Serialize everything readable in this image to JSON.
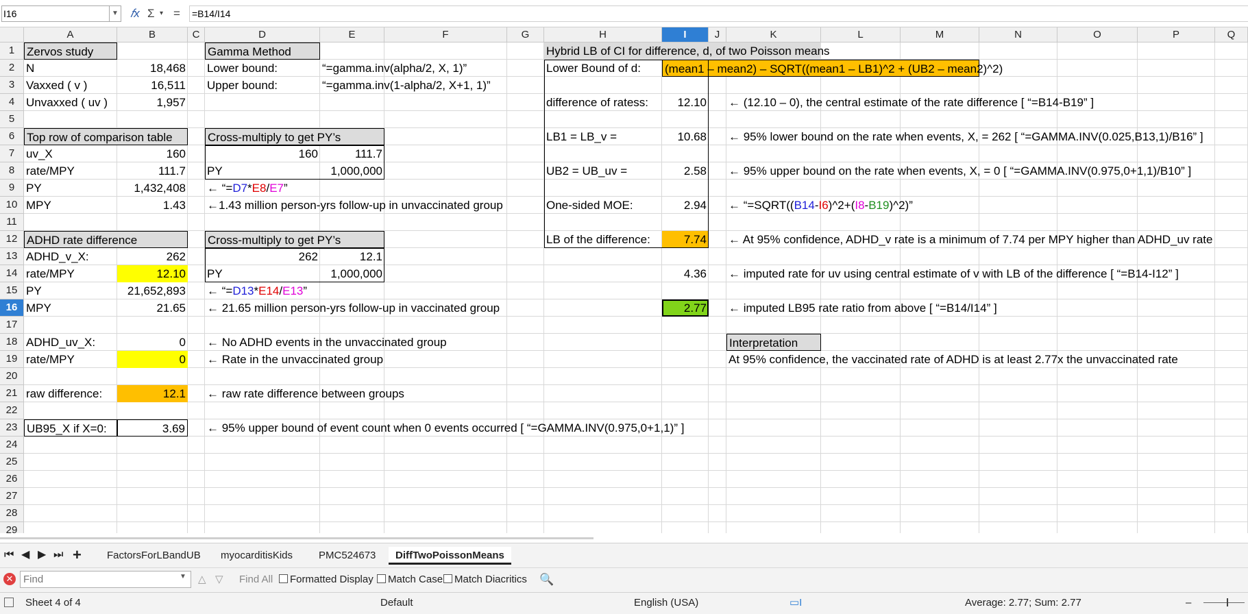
{
  "formula_bar": {
    "name_box": "I16",
    "function_wizard_icon": "fx-icon",
    "sum_icon": "sigma-icon",
    "equals_icon": "equals-icon",
    "formula": "=B14/I14"
  },
  "columns": [
    "A",
    "B",
    "C",
    "D",
    "E",
    "F",
    "G",
    "H",
    "I",
    "J",
    "K",
    "L",
    "M",
    "N",
    "O",
    "P",
    "Q"
  ],
  "selected_column": "I",
  "rows": [
    "1",
    "2",
    "3",
    "4",
    "5",
    "6",
    "7",
    "8",
    "9",
    "10",
    "11",
    "12",
    "13",
    "14",
    "15",
    "16",
    "17",
    "18",
    "19",
    "20",
    "21",
    "22",
    "23",
    "24",
    "25",
    "26",
    "27",
    "28",
    "29"
  ],
  "selected_row": "16",
  "cells": {
    "A1": "Zervos study",
    "D1": "Gamma Method",
    "H1": "Hybrid LB of CI for difference, d,  of two Poisson means",
    "A2": "N",
    "B2": "18,468",
    "D2": "Lower bound:",
    "E2": "“=gamma.inv(alpha/2, X, 1)”",
    "H2": "Lower Bound of d:",
    "I2": "(mean1 – mean2)  –  SQRT((mean1 – LB1)^2 + (UB2 – mean2)^2)",
    "A3": "Vaxxed ( v )",
    "B3": "16,511",
    "D3": "Upper bound:",
    "E3": "“=gamma.inv(1-alpha/2, X+1, 1)”",
    "A4": "Unvaxxed ( uv )",
    "B4": "1,957",
    "H4": "difference of ratess:",
    "I4": "12.10",
    "K4": "← (12.10 – 0), the central estimate of the rate difference [ “=B14-B19” ]",
    "A6": "Top row of comparison table",
    "D6": "Cross-multiply to get PY’s",
    "H6": "LB1 = LB_v =",
    "I6": "10.68",
    "K6": "← 95% lower bound on the rate when events, X, = 262 [ “=GAMMA.INV(0.025,B13,1)/B16” ]",
    "A7": "uv_X",
    "B7": "160",
    "D7": "160",
    "E7": "111.7",
    "A8": "rate/MPY",
    "B8": "111.7",
    "D8": "PY",
    "E8": "1,000,000",
    "H8": "UB2 = UB_uv =",
    "I8": "2.58",
    "K8": "← 95% upper bound on the rate when events, X, = 0 [ “=GAMMA.INV(0.975,0+1,1)/B10” ]",
    "A9": "PY",
    "B9": "1,432,408",
    "D9": {
      "pre": "← “=",
      "p1": "D7",
      "op1": "*",
      "p2": "E8",
      "op2": "/",
      "p3": "E7",
      "post": "”"
    },
    "A10": "MPY",
    "B10": "1.43",
    "D10": "←1.43 million person-yrs follow-up in unvaccinated group",
    "H10": "One-sided MOE:",
    "I10": "2.94",
    "K10": {
      "pre": "← “=SQRT((",
      "p1": "B14",
      "op1": "-",
      "p2": "I6",
      "mid": ")^2+(",
      "p3": "I8",
      "op2": "-",
      "p4": "B19",
      "post": ")^2)”"
    },
    "A12": "ADHD rate difference",
    "D12": "Cross-multiply to get PY’s",
    "H12": "LB of the difference:",
    "I12": "7.74",
    "K12": "← At 95% confidence, ADHD_v rate is a minimum of 7.74 per MPY higher than ADHD_uv rate",
    "A13": "ADHD_v_X:",
    "B13": "262",
    "D13": "262",
    "E13": "12.1",
    "A14": "rate/MPY",
    "B14": "12.10",
    "D14": "PY",
    "E14": "1,000,000",
    "I14": "4.36",
    "K14": "← imputed rate for uv using central estimate of v with LB of the difference [ “=B14-I12” ]",
    "A15": "PY",
    "B15": "21,652,893",
    "D15": {
      "pre": "← “=",
      "p1": "D13",
      "op1": "*",
      "p2": "E14",
      "op2": "/",
      "p3": "E13",
      "post": "”"
    },
    "A16": "MPY",
    "B16": "21.65",
    "D16": "← 21.65 million person-yrs follow-up in vaccinated group",
    "I16": "2.77",
    "K16": "← imputed LB95 rate ratio from above [ “=B14/I14” ]",
    "A18": "ADHD_uv_X:",
    "B18": "0",
    "D18": "← No ADHD events in the unvaccinated group",
    "K18": "Interpretation",
    "A19": "rate/MPY",
    "B19": "0",
    "D19": "← Rate in the unvaccinated group",
    "K19": "At 95% confidence, the vaccinated rate of ADHD is at least 2.77x the unvaccinated rate",
    "A21": "raw difference:",
    "B21": "12.1",
    "D21": "← raw rate difference between groups",
    "A23": "UB95_X if X=0:",
    "B23": "3.69",
    "D23": "← 95% upper bound of event count when 0 events occurred [ “=GAMMA.INV(0.975,0+1,1)” ]"
  },
  "colors": {
    "yellow_fill": "#ffff00",
    "orange_fill": "#ffbf00",
    "green_fill": "#81d41a",
    "header_gray": "#dcdcdc",
    "ref_blue": "#1f1fd8",
    "ref_red": "#e00000",
    "ref_magenta": "#e000d8",
    "ref_green": "#1f8f1f"
  },
  "sheet_tabs": {
    "nav_icons": [
      "first-sheet-icon",
      "prev-sheet-icon",
      "next-sheet-icon",
      "last-sheet-icon",
      "add-sheet-icon"
    ],
    "tabs": [
      "FactorsForLBandUB",
      "myocarditisKids",
      "PMC524673",
      "DiffTwoPoissonMeans"
    ],
    "active": "DiffTwoPoissonMeans"
  },
  "find_bar": {
    "placeholder": "Find",
    "find_all": "Find All",
    "formatted_display": "Formatted Display",
    "match_case": "Match Case",
    "match_diacritics": "Match Diacritics"
  },
  "status_bar": {
    "sheet": "Sheet 4 of 4",
    "page_style": "Default",
    "language": "English (USA)",
    "summary": "Average: 2.77; Sum: 2.77"
  }
}
